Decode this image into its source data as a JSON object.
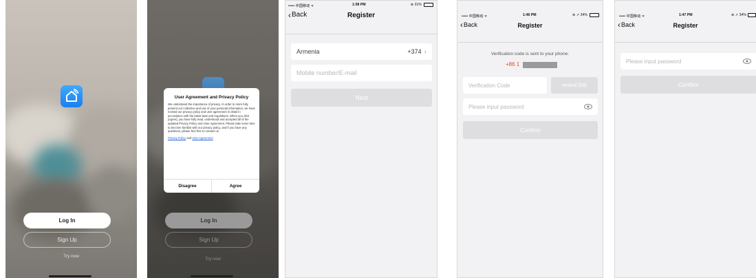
{
  "splash": {
    "login_label": "Log In",
    "signup_label": "Sign Up",
    "trynow_label": "Try now"
  },
  "privacy_dialog": {
    "title": "User Agreement and Privacy Policy",
    "body": "We understand the importance of privacy. In order to more fully present our collection and use of your personal information, we have revised our privacy policy and user agreement in detail in accordance with the latest laws and regulations. When you click [Agree], you have fully read, understood and accepted all of the updated Privacy Policy and User Agreement. Please take some time to become familiar with our privacy policy, and if you have any questions, please feel free to contact us.",
    "privacy_link": "Privacy Policy",
    "and_text": "and",
    "agreement_link": "User Agreement",
    "disagree_label": "Disagree",
    "agree_label": "Agree"
  },
  "register_phone": {
    "status": {
      "carrier": "••••• 中国移动 ᯤ",
      "time": "1:58 PM",
      "battery": "⊕ 31%"
    },
    "back_label": "Back",
    "title": "Register",
    "country": "Armenia",
    "country_code": "+374",
    "account_placeholder": "Mobile number/E-mail",
    "next_label": "Next"
  },
  "register_code": {
    "status": {
      "carrier": "••••• 中国移动 ᯤ",
      "time": "1:46 PM",
      "battery": "⊕ ➚ 34%"
    },
    "back_label": "Back",
    "title": "Register",
    "sent_text": "Verification code is sent to your phone:",
    "phone_prefix": "+86 1",
    "code_placeholder": "Verification Code",
    "resend_label": "resend (59)",
    "password_placeholder": "Please input password",
    "confirm_label": "Confirm"
  },
  "register_password": {
    "status": {
      "carrier": "••••• 中国移动 ᯤ",
      "time": "1:47 PM",
      "battery": "⊕ ➚ 34%"
    },
    "back_label": "Back",
    "title": "Register",
    "password_placeholder": "Please input password",
    "confirm_label": "Confirm"
  },
  "colors": {
    "brand_blue": "#1a7ff0",
    "phone_red": "#e8442f",
    "disabled_gray": "#dedee0"
  },
  "icons": [
    "app-logo-icon",
    "chevron-left-icon",
    "chevron-right-icon",
    "eye-icon",
    "wifi-icon",
    "battery-icon"
  ]
}
